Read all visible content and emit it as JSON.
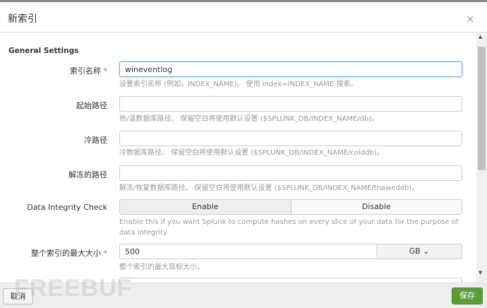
{
  "dialog": {
    "title": "新索引",
    "close": "×"
  },
  "section": "General Settings",
  "fields": {
    "name": {
      "label": "索引名称",
      "required": "*",
      "value": "wineventlog",
      "help": "设置索引名称 (例如，INDEX_NAME)。 使用 index=INDEX_NAME 搜索。"
    },
    "home": {
      "label": "起始路径",
      "value": "",
      "help": "热/温数据库路径。 保留空白将使用默认设置 ($SPLUNK_DB/INDEX_NAME/db)。"
    },
    "cold": {
      "label": "冷路径",
      "value": "",
      "help": "冷数据库路径。 保留空白将使用默认设置 ($SPLUNK_DB/INDEX_NAME/colddb)。"
    },
    "thawed": {
      "label": "解冻的路径",
      "value": "",
      "help": "解冻/恢复数据库路径。 保留空白将使用默认设置 ($SPLUNK_DB/INDEX_NAME/thaweddb)。"
    },
    "integrity": {
      "label": "Data Integrity Check",
      "options": [
        "Enable",
        "Disable"
      ],
      "selected": "Enable",
      "help": "Enable this if you want Splunk to compute hashes on every slice of your data for the purpose of data integrity."
    },
    "maxsize": {
      "label": "整个索引的最大大小",
      "required": "*",
      "value": "500",
      "unit": "GB",
      "help": "整个索引的最大目标大小。"
    }
  },
  "footer": {
    "cancel": "取消",
    "save": "保存"
  },
  "watermark": "FREEBUF"
}
